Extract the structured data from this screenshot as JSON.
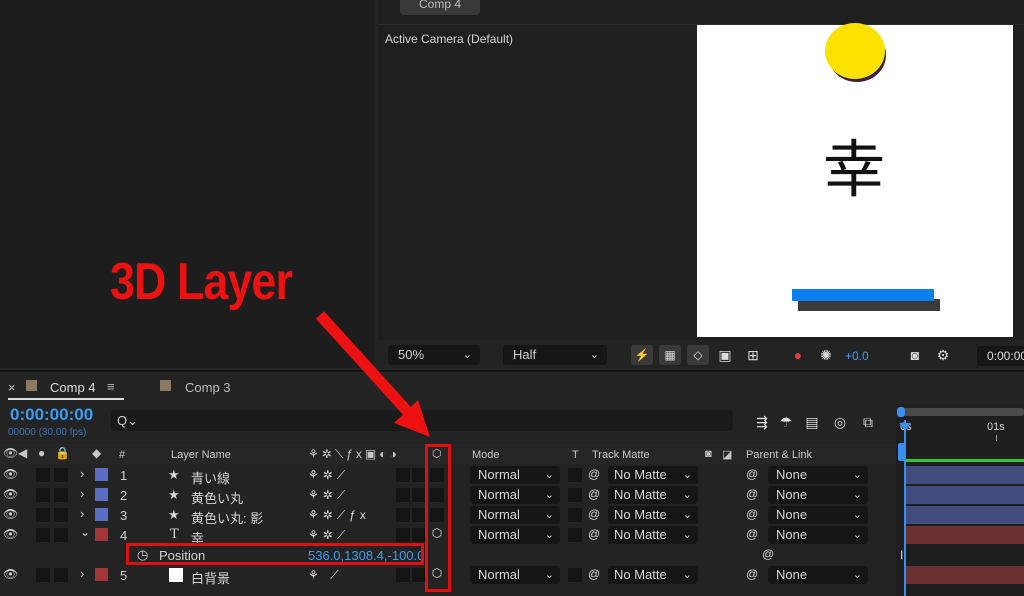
{
  "viewer": {
    "comp_tab": "Comp 4",
    "camera_label": "Active Camera (Default)",
    "kanji": "幸",
    "zoom": "50%",
    "resolution": "Half",
    "exposure": "+0.0",
    "timecode_short": "0:00:00"
  },
  "annotation": {
    "label": "3D Layer"
  },
  "timeline": {
    "tabs": [
      {
        "label": "Comp 4",
        "color": "#8a7a62",
        "active": true
      },
      {
        "label": "Comp 3",
        "color": "#8a7a62",
        "active": false
      }
    ],
    "time": "0:00:00:00",
    "frames": "00000 (30.00 fps)",
    "search_glyph": "Q⌄",
    "columns": {
      "number": "#",
      "layer_name": "Layer Name",
      "mode": "Mode",
      "t": "T",
      "track_matte": "Track Matte",
      "parent": "Parent & Link"
    },
    "ruler": [
      "0s",
      "01s"
    ],
    "layers": [
      {
        "num": "1",
        "icon": "★",
        "name": "青い線",
        "label_color": "#5a6fc4",
        "mode": "Normal",
        "matte": "No Matte",
        "parent": "None",
        "fx": false,
        "three_d": false
      },
      {
        "num": "2",
        "icon": "★",
        "name": "黄色い丸",
        "label_color": "#5a6fc4",
        "mode": "Normal",
        "matte": "No Matte",
        "parent": "None",
        "fx": false,
        "three_d": false
      },
      {
        "num": "3",
        "icon": "★",
        "name": "黄色い丸: 影",
        "label_color": "#5a6fc4",
        "mode": "Normal",
        "matte": "No Matte",
        "parent": "None",
        "fx": true,
        "three_d": false
      },
      {
        "num": "4",
        "icon": "T",
        "name": "幸",
        "label_color": "#a33636",
        "mode": "Normal",
        "matte": "No Matte",
        "parent": "None",
        "fx": false,
        "three_d": true
      },
      {
        "num": "5",
        "icon": "",
        "name": "白背景",
        "label_color": "#a33636",
        "mode": "Normal",
        "matte": "No Matte",
        "parent": "None",
        "fx": false,
        "three_d": true
      }
    ],
    "position_property": {
      "label": "Position",
      "value": "536.0,1308.4,-100.0"
    }
  },
  "colors": {
    "accent_blue": "#3a9cf2",
    "annotation_red": "#ee1111"
  }
}
